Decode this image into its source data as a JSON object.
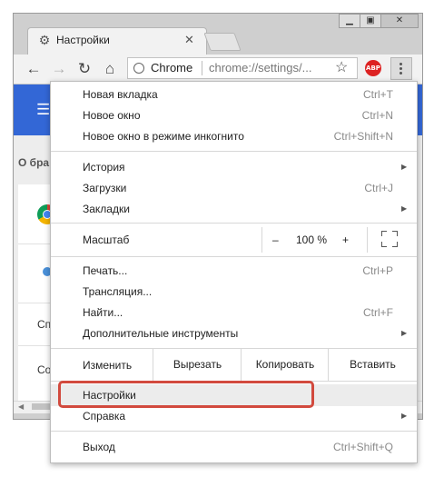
{
  "browser": {
    "tab_title": "Настройки",
    "tab_icon": "gear-icon",
    "omnibox_app": "Chrome",
    "omnibox_url": "chrome://settings/...",
    "abp_label": "ABP"
  },
  "page": {
    "about_prefix": "О бра",
    "row_frag_1": "Сп",
    "row_frag_2": "Со"
  },
  "menu": {
    "group1": [
      {
        "label": "Новая вкладка",
        "shortcut": "Ctrl+T"
      },
      {
        "label": "Новое окно",
        "shortcut": "Ctrl+N"
      },
      {
        "label": "Новое окно в режиме инкогнито",
        "shortcut": "Ctrl+Shift+N"
      }
    ],
    "group2": [
      {
        "label": "История",
        "shortcut": ""
      },
      {
        "label": "Загрузки",
        "shortcut": "Ctrl+J"
      },
      {
        "label": "Закладки",
        "shortcut": ""
      }
    ],
    "zoom": {
      "label": "Масштаб",
      "minus": "–",
      "value": "100 %",
      "plus": "+"
    },
    "group3": [
      {
        "label": "Печать...",
        "shortcut": "Ctrl+P"
      },
      {
        "label": "Трансляция...",
        "shortcut": ""
      },
      {
        "label": "Найти...",
        "shortcut": "Ctrl+F"
      },
      {
        "label": "Дополнительные инструменты",
        "shortcut": ""
      }
    ],
    "edit": {
      "label": "Изменить",
      "cut": "Вырезать",
      "copy": "Копировать",
      "paste": "Вставить"
    },
    "settings": {
      "label": "Настройки"
    },
    "help": {
      "label": "Справка"
    },
    "exit": {
      "label": "Выход",
      "shortcut": "Ctrl+Shift+Q"
    }
  },
  "colors": {
    "highlight_frame": "#d24a3e",
    "header_blue": "#3367d6",
    "abp_red": "#dd2222"
  }
}
